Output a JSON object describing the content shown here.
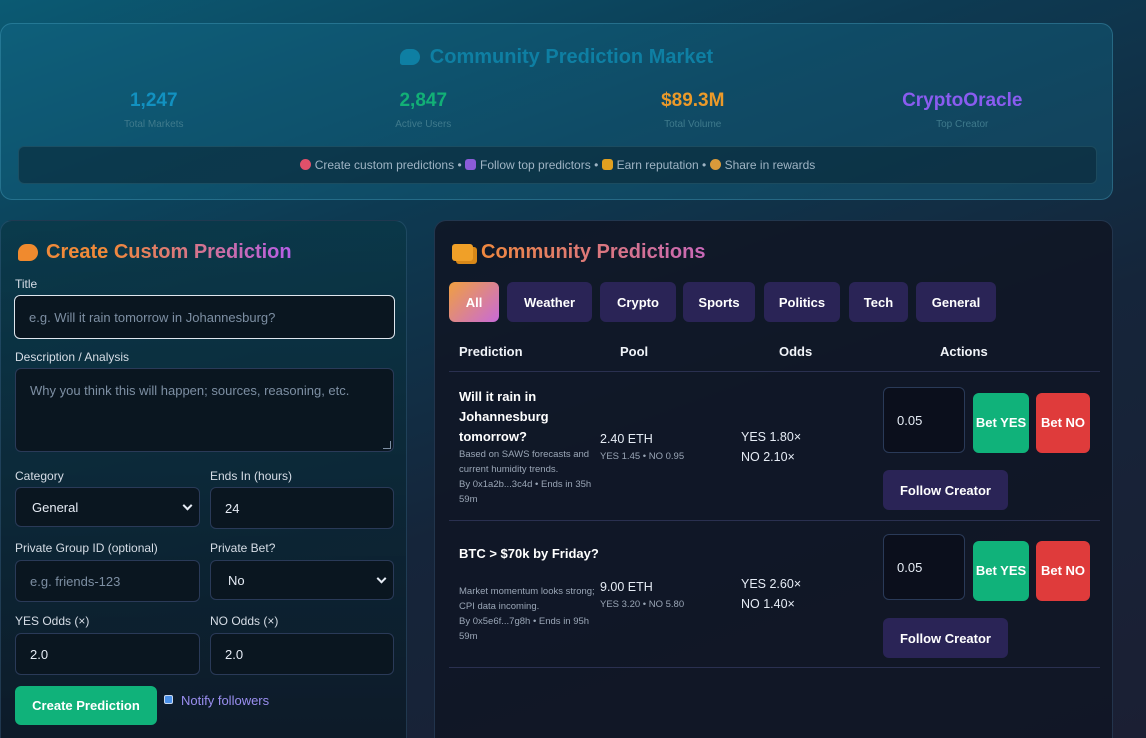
{
  "hero": {
    "title": "Community Prediction Market",
    "stats": [
      {
        "value": "1,247",
        "label": "Total Markets",
        "color": "#1291c0"
      },
      {
        "value": "2,847",
        "label": "Active Users",
        "color": "#12b076"
      },
      {
        "value": "$89.3M",
        "label": "Total Volume",
        "color": "#eb9a2a"
      },
      {
        "value": "CryptoOracle",
        "label": "Top Creator",
        "color": "#8a5cf0"
      }
    ],
    "features": [
      "Create custom predictions",
      "Follow top predictors",
      "Earn reputation",
      "Share in rewards"
    ],
    "separator": "•"
  },
  "create": {
    "title_a": "Create ",
    "title_b": "Custom Prediction",
    "title_label": "Title",
    "title_placeholder": "e.g. Will it rain tomorrow in Johannesburg?",
    "desc_label": "Description / Analysis",
    "desc_placeholder": "Why you think this will happen; sources, reasoning, etc.",
    "category_label": "Category",
    "category_value": "General",
    "ends_label": "Ends In (hours)",
    "ends_value": "24",
    "group_label": "Private Group ID (optional)",
    "group_placeholder": "e.g. friends-123",
    "private_label": "Private Bet?",
    "private_value": "No",
    "yes_label": "YES Odds (×)",
    "yes_value": "2.0",
    "no_label": "NO Odds (×)",
    "no_value": "2.0",
    "submit": "Create Prediction",
    "notify": "Notify followers"
  },
  "community": {
    "title": "Community Predictions",
    "filters": [
      "All",
      "Weather",
      "Crypto",
      "Sports",
      "Politics",
      "Tech",
      "General"
    ],
    "headers": {
      "prediction": "Prediction",
      "pool": "Pool",
      "odds": "Odds",
      "actions": "Actions"
    },
    "rows": [
      {
        "question": "Will it rain in Johannesburg tomorrow?",
        "desc": "Based on SAWS forecasts and current humidity trends.",
        "meta": "By 0x1a2b...3c4d • Ends in 35h 59m",
        "pool": "2.40 ETH",
        "pool_split": "YES 1.45 • NO 0.95",
        "odds_yes": "YES 1.80×",
        "odds_no": "NO 2.10×",
        "amount": "0.05"
      },
      {
        "question": "BTC > $70k by Friday?",
        "desc": "Market momentum looks strong; CPI data incoming.",
        "meta": "By 0x5e6f...7g8h • Ends in 95h 59m",
        "pool": "9.00 ETH",
        "pool_split": "YES 3.20 • NO 5.80",
        "odds_yes": "YES 2.60×",
        "odds_no": "NO 1.40×",
        "amount": "0.05"
      }
    ],
    "bet_yes": "Bet YES",
    "bet_no": "Bet NO",
    "follow": "Follow Creator"
  }
}
